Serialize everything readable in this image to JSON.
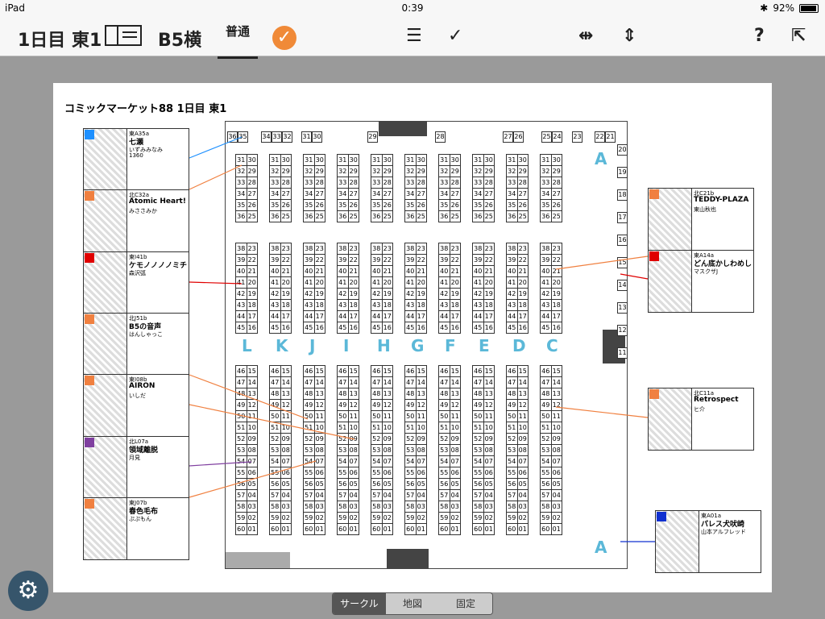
{
  "status": {
    "carrier": "iPad",
    "time": "0:39",
    "battery": "92%"
  },
  "toolbar": {
    "day": "1日目 東1",
    "paper": "B5横",
    "line_label": "普通"
  },
  "map_title": "コミックマーケット88 1日目 東1",
  "block_letters": [
    "L",
    "K",
    "J",
    "I",
    "H",
    "G",
    "F",
    "E",
    "D",
    "C"
  ],
  "top_numbers": [
    [
      "36",
      "35"
    ],
    [
      "34",
      "33",
      "32"
    ],
    [
      "31",
      "30"
    ],
    [
      "29"
    ],
    [
      "28"
    ],
    [
      "27",
      "26"
    ],
    [
      "25",
      "24"
    ],
    [
      "23"
    ],
    [
      "22",
      "21"
    ]
  ],
  "block_a": {
    "label_top": "A",
    "label_bottom": "A"
  },
  "segments": [
    "サークル",
    "地図",
    "固定"
  ],
  "circles": [
    {
      "code": "東A35a",
      "name": "七瀬",
      "author": "いずみみなみ",
      "extra": "1360",
      "color": "#1e90ff"
    },
    {
      "code": "北C32a",
      "name": "Atomic Heart!",
      "author": "みささみか",
      "extra": "",
      "color": "#f08040"
    },
    {
      "code": "東I41b",
      "name": "ケモノノノノミチ",
      "author": "森沢弧",
      "extra": "",
      "color": "#e00000"
    },
    {
      "code": "北J51b",
      "name": "B5の音声",
      "author": "はんしゃっこ",
      "extra": "",
      "color": "#f08040"
    },
    {
      "code": "東I08b",
      "name": "AIRON",
      "author": "いしだ",
      "extra": "",
      "color": "#f08040"
    },
    {
      "code": "北L07a",
      "name": "領域離脱",
      "author": "月見",
      "extra": "",
      "color": "#8040a0"
    },
    {
      "code": "東J07b",
      "name": "春色毛布",
      "author": "ぷぷもん",
      "extra": "",
      "color": "#f08040"
    },
    {
      "code": "北C21b",
      "name": "TEDDY-PLAZA",
      "author": "東山秋也",
      "extra": "",
      "color": "#f08040"
    },
    {
      "code": "東A14a",
      "name": "どん底かしわめし",
      "author": "マスクザJ",
      "extra": "",
      "color": "#e00000"
    },
    {
      "code": "北C11a",
      "name": "Retrospect",
      "author": "ヒ介",
      "extra": "",
      "color": "#f08040"
    },
    {
      "code": "東A01a",
      "name": "パレス犬吠崎",
      "author": "山本アルフレッド",
      "extra": "",
      "color": "#1030d0"
    }
  ]
}
